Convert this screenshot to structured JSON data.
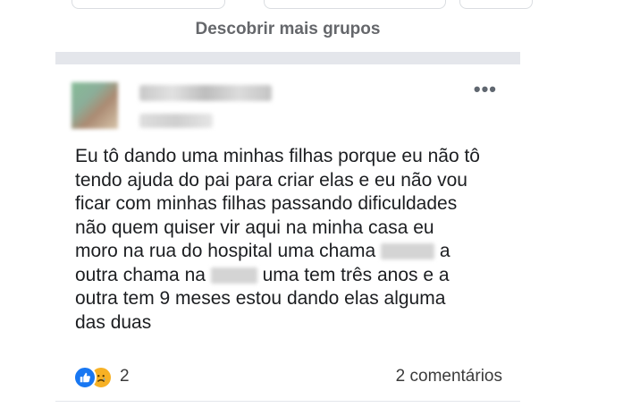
{
  "header": {
    "discover_label": "Descobrir mais grupos"
  },
  "post": {
    "author_name": "",
    "meta": "",
    "more_icon": "more-options-icon",
    "lines": [
      "Eu tô dando uma minhas filhas porque eu não tô",
      "tendo ajuda do pai para criar elas e eu não vou",
      "ficar com minhas filhas passando dificuldades",
      "não quem quiser vir aqui na minha casa eu",
      "moro na rua do hospital uma chama",
      "a",
      "outra chama na",
      "uma tem três anos e a",
      "outra tem 9 meses estou dando elas alguma",
      "das duas"
    ]
  },
  "footer": {
    "reaction_count": "2",
    "comments_label": "2 comentários",
    "colors": {
      "like": "#1877f2",
      "sad": "#f7b125"
    }
  }
}
